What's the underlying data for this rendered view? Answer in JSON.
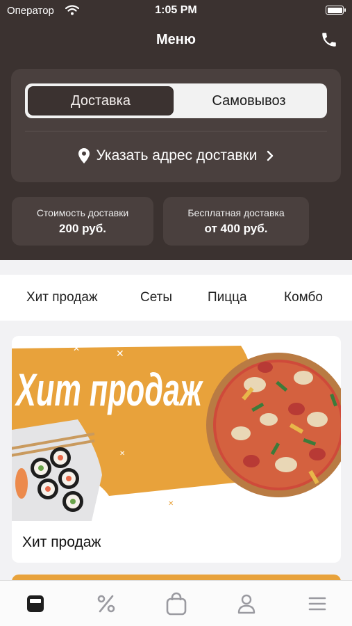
{
  "status_bar": {
    "carrier": "Оператор",
    "time": "1:05 PM"
  },
  "nav": {
    "title": "Меню",
    "call_icon": "phone-icon"
  },
  "delivery": {
    "modes": [
      {
        "label": "Доставка",
        "active": true
      },
      {
        "label": "Самовывоз",
        "active": false
      }
    ],
    "address_prompt": "Указать адрес доставки"
  },
  "info_cards": [
    {
      "label": "Стоимость доставки",
      "value": "200 руб."
    },
    {
      "label": "Бесплатная доставка",
      "value": "от 400 руб."
    }
  ],
  "categories": [
    "Хит продаж",
    "Сеты",
    "Пицца",
    "Комбо"
  ],
  "promo": {
    "banner_text": "Хит продаж",
    "title": "Хит продаж"
  },
  "tab_bar": {
    "items": [
      {
        "icon": "menu-icon",
        "active": true
      },
      {
        "icon": "percent-icon",
        "active": false
      },
      {
        "icon": "bag-icon",
        "active": false
      },
      {
        "icon": "profile-icon",
        "active": false
      },
      {
        "icon": "more-icon",
        "active": false
      }
    ]
  },
  "colors": {
    "header_bg": "#3b3230",
    "card_bg": "#4a403e",
    "accent": "#e8a23b"
  }
}
